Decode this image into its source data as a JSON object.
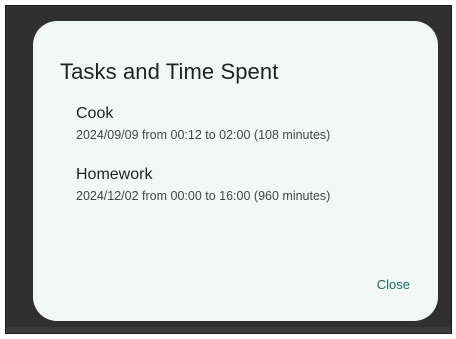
{
  "dialog": {
    "title": "Tasks and Time Spent",
    "tasks": [
      {
        "name": "Cook",
        "detail": "2024/09/09 from 00:12 to 02:00 (108 minutes)"
      },
      {
        "name": "Homework",
        "detail": "2024/12/02 from 00:00 to 16:00 (960 minutes)"
      }
    ],
    "close_label": "Close"
  },
  "colors": {
    "backdrop": "#303030",
    "dialog_surface": "#f1f8f6",
    "primary_text": "#1d2322",
    "secondary_text": "#404946",
    "accent": "#1d6b63"
  }
}
